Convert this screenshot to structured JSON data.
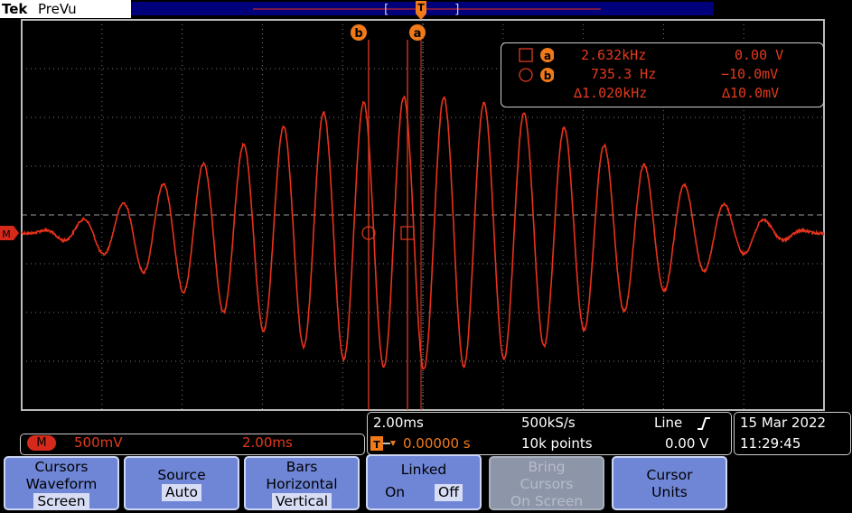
{
  "brand": {
    "tek": "Tek",
    "mode": "PreVu"
  },
  "markers": {
    "cursor_a": "a",
    "cursor_b": "b",
    "channel": "M",
    "trigger_pos": "T"
  },
  "readout": {
    "a_freq": "2.632kHz",
    "a_volt": "0.00 V",
    "b_freq": "735.3 Hz",
    "b_volt": "−10.0mV",
    "delta_freq": "∆1.020kHz",
    "delta_volt": "∆10.0mV"
  },
  "status": {
    "channel": "M",
    "volts_div": "500mV",
    "time_div": "2.00ms",
    "timebase": "2.00ms",
    "trigger_offset": "0.00000 s",
    "sample_rate": "500kS/s",
    "record_length": "10k points",
    "trigger_type": "Line",
    "trigger_level": "0.00 V",
    "date": "15 Mar 2022",
    "time": "11:29:45"
  },
  "menu": [
    {
      "line1": "Cursors",
      "line2": "Waveform",
      "line3": "Screen",
      "selected": "Screen"
    },
    {
      "line1": "Source",
      "line2": "Auto"
    },
    {
      "line1": "Bars",
      "line2": "Horizontal",
      "line3": "Vertical"
    },
    {
      "line1": "Linked",
      "on": "On",
      "off": "Off"
    },
    {
      "line1": "Bring",
      "line2": "Cursors",
      "line3": "On Screen"
    },
    {
      "line1": "Cursor",
      "line2": "Units"
    }
  ],
  "colors": {
    "trace": "#e8321c",
    "cursor": "#e23a1e",
    "menu": "#6f85d6",
    "accent_orange": "#f07a1a"
  },
  "waveform": {
    "description_values": "amplitude-modulated sine burst",
    "cycles": 20,
    "peak_divisions": 2.8
  }
}
